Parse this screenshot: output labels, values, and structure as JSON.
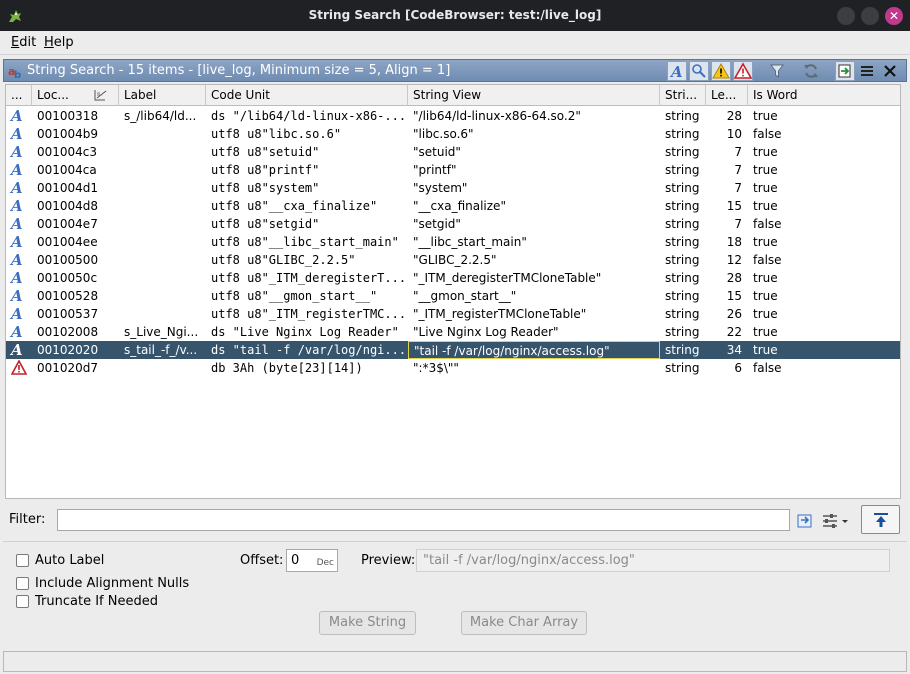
{
  "window": {
    "title": "String Search [CodeBrowser: test:/live_log]"
  },
  "menubar": {
    "items": [
      {
        "mnemonic": "E",
        "rest": "dit"
      },
      {
        "mnemonic": "H",
        "rest": "elp"
      }
    ]
  },
  "provider": {
    "title": "String Search - 15 items - [live_log, Minimum size = 5, Align = 1]",
    "toolbar_icons": [
      "string-type-icon",
      "search-icon",
      "warning-icon",
      "error-icon",
      "filter-icon",
      "refresh-icon",
      "export-icon",
      "menu-icon",
      "close-icon"
    ]
  },
  "table": {
    "columns": [
      "...",
      "Loc...",
      "Label",
      "Code Unit",
      "String View",
      "Stri...",
      "Le...",
      "Is Word"
    ],
    "rows": [
      {
        "icon": "A",
        "loc": "00100318",
        "label": "s_/lib64/ld...",
        "code": "ds \"/lib64/ld-linux-x86-...",
        "view": "\"/lib64/ld-linux-x86-64.so.2\"",
        "type": "string",
        "len": "28",
        "word": "true"
      },
      {
        "icon": "A",
        "loc": "001004b9",
        "label": "",
        "code": "utf8 u8\"libc.so.6\"",
        "view": "\"libc.so.6\"",
        "type": "string",
        "len": "10",
        "word": "false"
      },
      {
        "icon": "A",
        "loc": "001004c3",
        "label": "",
        "code": "utf8 u8\"setuid\"",
        "view": "\"setuid\"",
        "type": "string",
        "len": "7",
        "word": "true"
      },
      {
        "icon": "A",
        "loc": "001004ca",
        "label": "",
        "code": "utf8 u8\"printf\"",
        "view": "\"printf\"",
        "type": "string",
        "len": "7",
        "word": "true"
      },
      {
        "icon": "A",
        "loc": "001004d1",
        "label": "",
        "code": "utf8 u8\"system\"",
        "view": "\"system\"",
        "type": "string",
        "len": "7",
        "word": "true"
      },
      {
        "icon": "A",
        "loc": "001004d8",
        "label": "",
        "code": "utf8 u8\"__cxa_finalize\"",
        "view": "\"__cxa_finalize\"",
        "type": "string",
        "len": "15",
        "word": "true"
      },
      {
        "icon": "A",
        "loc": "001004e7",
        "label": "",
        "code": "utf8 u8\"setgid\"",
        "view": "\"setgid\"",
        "type": "string",
        "len": "7",
        "word": "false"
      },
      {
        "icon": "A",
        "loc": "001004ee",
        "label": "",
        "code": "utf8 u8\"__libc_start_main\"",
        "view": "\"__libc_start_main\"",
        "type": "string",
        "len": "18",
        "word": "true"
      },
      {
        "icon": "A",
        "loc": "00100500",
        "label": "",
        "code": "utf8 u8\"GLIBC_2.2.5\"",
        "view": "\"GLIBC_2.2.5\"",
        "type": "string",
        "len": "12",
        "word": "false"
      },
      {
        "icon": "A",
        "loc": "0010050c",
        "label": "",
        "code": "utf8 u8\"_ITM_deregisterT...",
        "view": "\"_ITM_deregisterTMCloneTable\"",
        "type": "string",
        "len": "28",
        "word": "true"
      },
      {
        "icon": "A",
        "loc": "00100528",
        "label": "",
        "code": "utf8 u8\"__gmon_start__\"",
        "view": "\"__gmon_start__\"",
        "type": "string",
        "len": "15",
        "word": "true"
      },
      {
        "icon": "A",
        "loc": "00100537",
        "label": "",
        "code": "utf8 u8\"_ITM_registerTMC...",
        "view": "\"_ITM_registerTMCloneTable\"",
        "type": "string",
        "len": "26",
        "word": "true"
      },
      {
        "icon": "A",
        "loc": "00102008",
        "label": "s_Live_Ngi...",
        "code": "ds \"Live Nginx Log Reader\"",
        "view": "\"Live Nginx Log Reader\"",
        "type": "string",
        "len": "22",
        "word": "true"
      },
      {
        "icon": "A",
        "loc": "00102020",
        "label": "s_tail_-f_/v...",
        "code": "ds \"tail -f /var/log/ngi...",
        "view": "\"tail -f /var/log/nginx/access.log\"",
        "type": "string",
        "len": "34",
        "word": "true",
        "selected": true
      },
      {
        "icon": "error",
        "loc": "001020d7",
        "label": "",
        "code": "db 3Ah (byte[23][14])",
        "view": "\":*3$\\\"\"",
        "type": "string",
        "len": "6",
        "word": "false"
      }
    ]
  },
  "filter": {
    "label": "Filter:",
    "value": ""
  },
  "options": {
    "auto_label": "Auto Label",
    "include_nulls": "Include Alignment Nulls",
    "truncate": "Truncate If Needed",
    "offset_label": "Offset:",
    "offset_value": "0",
    "offset_unit": "Dec",
    "preview_label": "Preview:",
    "preview_value": "\"tail -f /var/log/nginx/access.log\"",
    "make_string": "Make String",
    "make_char_array": "Make Char Array"
  },
  "colors": {
    "header_accent": "#7b96bb",
    "selection": "#37546d",
    "string_icon": "#3a6fc4",
    "error_icon": "#c8202a"
  }
}
